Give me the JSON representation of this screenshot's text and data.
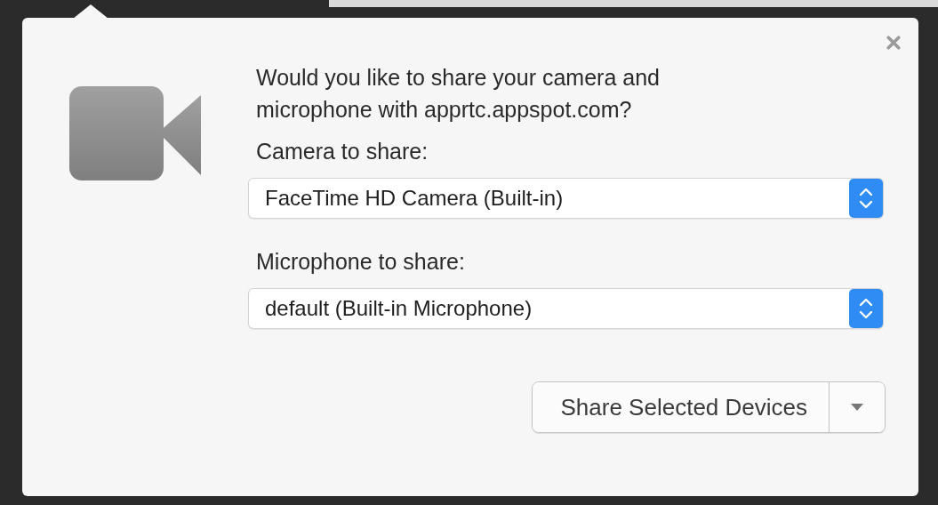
{
  "prompt": {
    "question": "Would you like to share your camera and microphone with apprtc.appspot.com?",
    "fields": [
      {
        "label": "Camera to share:",
        "value": "FaceTime HD Camera (Built-in)"
      },
      {
        "label": "Microphone to share:",
        "value": "default (Built-in Microphone)"
      }
    ],
    "primary_button": "Share Selected Devices"
  }
}
